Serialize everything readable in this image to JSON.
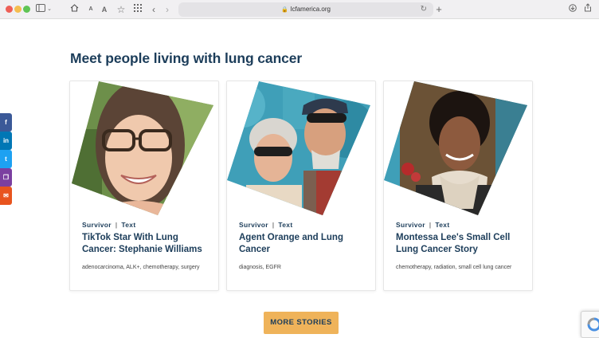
{
  "browser": {
    "url": "lcfamerica.org"
  },
  "page": {
    "heading": "Meet people living with lung cancer",
    "more_button": "MORE STORIES"
  },
  "cards": [
    {
      "category": "Survivor",
      "type": "Text",
      "title": "TikTok Star With Lung Cancer: Stephanie Williams",
      "tags": "adenocarcinoma, ALK+, chemotherapy, surgery"
    },
    {
      "category": "Survivor",
      "type": "Text",
      "title": "Agent Orange and Lung Cancer",
      "tags": "diagnosis, EGFR"
    },
    {
      "category": "Survivor",
      "type": "Text",
      "title": "Montessa Lee's Small Cell Lung Cancer Story",
      "tags": "chemotherapy, radiation, small cell lung cancer"
    }
  ],
  "share": [
    {
      "icon": "facebook-icon",
      "glyph": "f",
      "color": "#3b5998"
    },
    {
      "icon": "linkedin-icon",
      "glyph": "in",
      "color": "#0077b5"
    },
    {
      "icon": "twitter-icon",
      "glyph": "t",
      "color": "#1da1f2"
    },
    {
      "icon": "copy-icon",
      "glyph": "❐",
      "color": "#7b3fa0"
    },
    {
      "icon": "email-icon",
      "glyph": "✉",
      "color": "#e8541e"
    }
  ],
  "colors": {
    "navy": "#1c3d5a",
    "button": "#efb35a",
    "teal": "#3f9fb8"
  }
}
